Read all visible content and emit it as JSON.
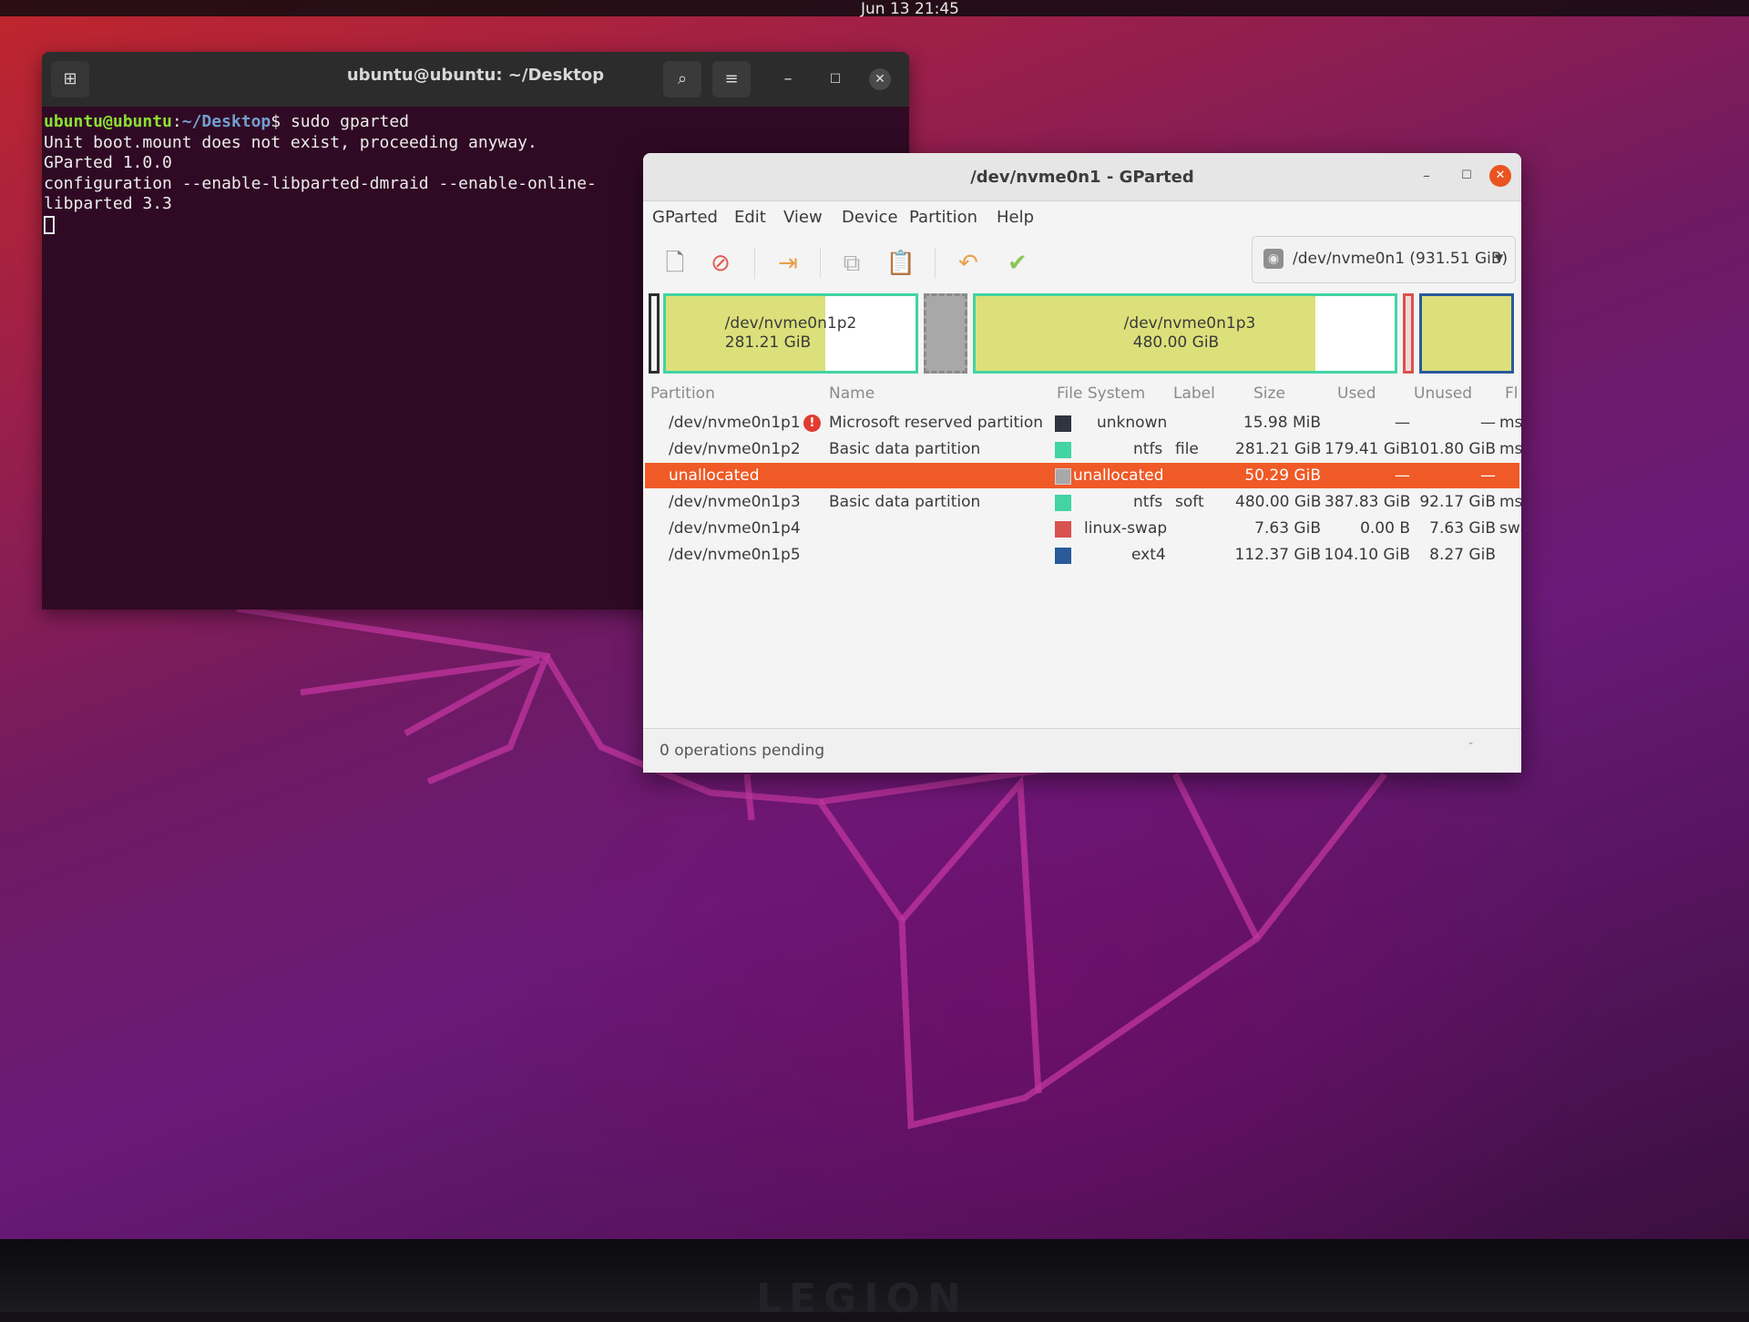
{
  "topbar": {
    "clock": "Jun 13  21:45"
  },
  "terminal": {
    "title": "ubuntu@ubuntu: ~/Desktop",
    "prompt_user": "ubuntu@ubuntu",
    "prompt_sep": ":",
    "prompt_path": "~/Desktop",
    "prompt_end": "$ ",
    "command": "sudo gparted",
    "output": [
      "Unit boot.mount does not exist, proceeding anyway.",
      "GParted 1.0.0",
      "configuration --enable-libparted-dmraid --enable-online-",
      "libparted 3.3"
    ]
  },
  "gparted": {
    "title": "/dev/nvme0n1 - GParted",
    "menu": [
      "GParted",
      "Edit",
      "View",
      "Device",
      "Partition",
      "Help"
    ],
    "device": "/dev/nvme0n1 (931.51 GiB)",
    "diskmap": {
      "p2": {
        "name": "/dev/nvme0n1p2",
        "size": "281.21 GiB",
        "used_fraction": 0.64
      },
      "p3": {
        "name": "/dev/nvme0n1p3",
        "size": "480.00 GiB",
        "used_fraction": 0.81
      }
    },
    "columns": [
      "Partition",
      "Name",
      "File System",
      "Label",
      "Size",
      "Used",
      "Unused",
      "Fl"
    ],
    "rows": [
      {
        "partition": "/dev/nvme0n1p1",
        "name": "Microsoft reserved partition",
        "fs": "unknown",
        "fs_color": "#2e3440",
        "label": "",
        "size": "15.98 MiB",
        "used": "—",
        "unused": "—",
        "flags": "msf",
        "warning": "!"
      },
      {
        "partition": "/dev/nvme0n1p2",
        "name": "Basic data partition",
        "fs": "ntfs",
        "fs_color": "#42d4a4",
        "label": "file",
        "size": "281.21 GiB",
        "used": "179.41 GiB",
        "unused": "101.80 GiB",
        "flags": "msf"
      },
      {
        "partition": "unallocated",
        "name": "",
        "fs": "unallocated",
        "fs_color": "#a8a8a8",
        "label": "",
        "size": "50.29 GiB",
        "used": "—",
        "unused": "—",
        "flags": ""
      },
      {
        "partition": "/dev/nvme0n1p3",
        "name": "Basic data partition",
        "fs": "ntfs",
        "fs_color": "#42d4a4",
        "label": "soft",
        "size": "480.00 GiB",
        "used": "387.83 GiB",
        "unused": "92.17 GiB",
        "flags": "msf"
      },
      {
        "partition": "/dev/nvme0n1p4",
        "name": "",
        "fs": "linux-swap",
        "fs_color": "#d9524f",
        "label": "",
        "size": "7.63 GiB",
        "used": "0.00 B",
        "unused": "7.63 GiB",
        "flags": "swa"
      },
      {
        "partition": "/dev/nvme0n1p5",
        "name": "",
        "fs": "ext4",
        "fs_color": "#2a5a9a",
        "label": "",
        "size": "112.37 GiB",
        "used": "104.10 GiB",
        "unused": "8.27 GiB",
        "flags": ""
      }
    ],
    "selected_row": 2,
    "status": "0 operations pending"
  },
  "bezel": {
    "brand": "LEGION"
  },
  "colors": {
    "selection": "#ef5a27",
    "ntfs": "#42d4a4",
    "used_fill": "#dce07a",
    "unallocated": "#a8a8a8",
    "swap": "#d9524f",
    "ext4": "#2a5a9a"
  },
  "icons": {
    "new": "new-partition-icon",
    "delete": "delete-icon",
    "resize": "resize-move-icon",
    "copy": "copy-icon",
    "paste": "paste-icon",
    "undo": "undo-icon",
    "apply": "apply-check-icon",
    "device": "harddisk-icon"
  }
}
